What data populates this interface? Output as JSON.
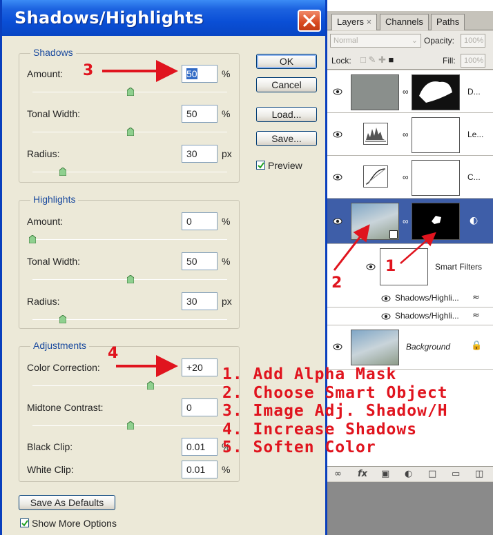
{
  "dialog": {
    "title": "Shadows/Highlights",
    "buttons": {
      "ok": "OK",
      "cancel": "Cancel",
      "load": "Load...",
      "save": "Save..."
    },
    "preview_label": "Preview",
    "shadows": {
      "legend": "Shadows",
      "amount_label": "Amount:",
      "amount_value": "50",
      "amount_unit": "%",
      "tonal_label": "Tonal Width:",
      "tonal_value": "50",
      "tonal_unit": "%",
      "radius_label": "Radius:",
      "radius_value": "30",
      "radius_unit": "px"
    },
    "highlights": {
      "legend": "Highlights",
      "amount_label": "Amount:",
      "amount_value": "0",
      "amount_unit": "%",
      "tonal_label": "Tonal Width:",
      "tonal_value": "50",
      "tonal_unit": "%",
      "radius_label": "Radius:",
      "radius_value": "30",
      "radius_unit": "px"
    },
    "adjustments": {
      "legend": "Adjustments",
      "color_label": "Color Correction:",
      "color_value": "+20",
      "midtone_label": "Midtone Contrast:",
      "midtone_value": "0",
      "black_label": "Black Clip:",
      "black_value": "0.01",
      "black_unit": "%",
      "white_label": "White Clip:",
      "white_value": "0.01",
      "white_unit": "%"
    },
    "save_defaults": "Save As Defaults",
    "show_more": "Show More Options"
  },
  "annotations": {
    "num1": "1",
    "num2": "2",
    "num3": "3",
    "num4": "4",
    "steps": [
      "1. Add Alpha Mask",
      "2. Choose Smart Object",
      "3. Image Adj. Shadow/H",
      "4. Increase Shadows",
      "5. Soften Color"
    ],
    "color": "#e0141e"
  },
  "layers_panel": {
    "tabs": [
      "Layers",
      "Channels",
      "Paths"
    ],
    "tab_close": "×",
    "blend_mode": "Normal",
    "opacity_label": "Opacity:",
    "opacity_value": "100%",
    "lock_label": "Lock:",
    "fill_label": "Fill:",
    "fill_value": "100%",
    "layers": [
      "D...",
      "Le...",
      "C...",
      "",
      "Smart Filters",
      "Shadows/Highli...",
      "Shadows/Highli...",
      "Background"
    ]
  },
  "colors": {
    "titlebar": "#0a4fd6",
    "selected_layer": "#3e5ea8",
    "dialog_bg": "#ece9d8"
  }
}
